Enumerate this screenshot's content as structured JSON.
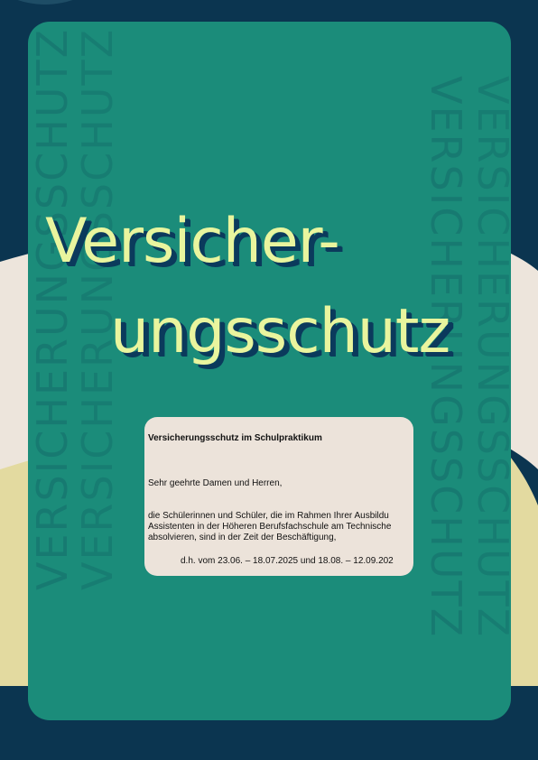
{
  "colors": {
    "page_bg": "#0b3550",
    "card_bg": "#1b8c7a",
    "title_fill": "#e9f59e",
    "title_shadow": "#0b3a5c",
    "letter_bg": "#ece3da",
    "band_beige": "#ede5dc",
    "band_yellow": "#e3daa0"
  },
  "watermark": {
    "text": "VERSICHERUNGSSCHUTZ"
  },
  "title": {
    "line1": "Versicher-",
    "line2": "ungsschutz"
  },
  "letter": {
    "subject": "Versicherungsschutz im Schulpraktikum",
    "greeting": "Sehr geehrte Damen und Herren,",
    "paragraph_lines": [
      "die Schülerinnen und Schüler, die im Rahmen Ihrer Ausbildu",
      "Assistenten in der Höheren Berufsfachschule am Technische",
      "absolvieren, sind in der Zeit der Beschäftigung,"
    ],
    "dates": "d.h. vom 23.06. – 18.07.2025 und 18.08. – 12.09.202"
  }
}
